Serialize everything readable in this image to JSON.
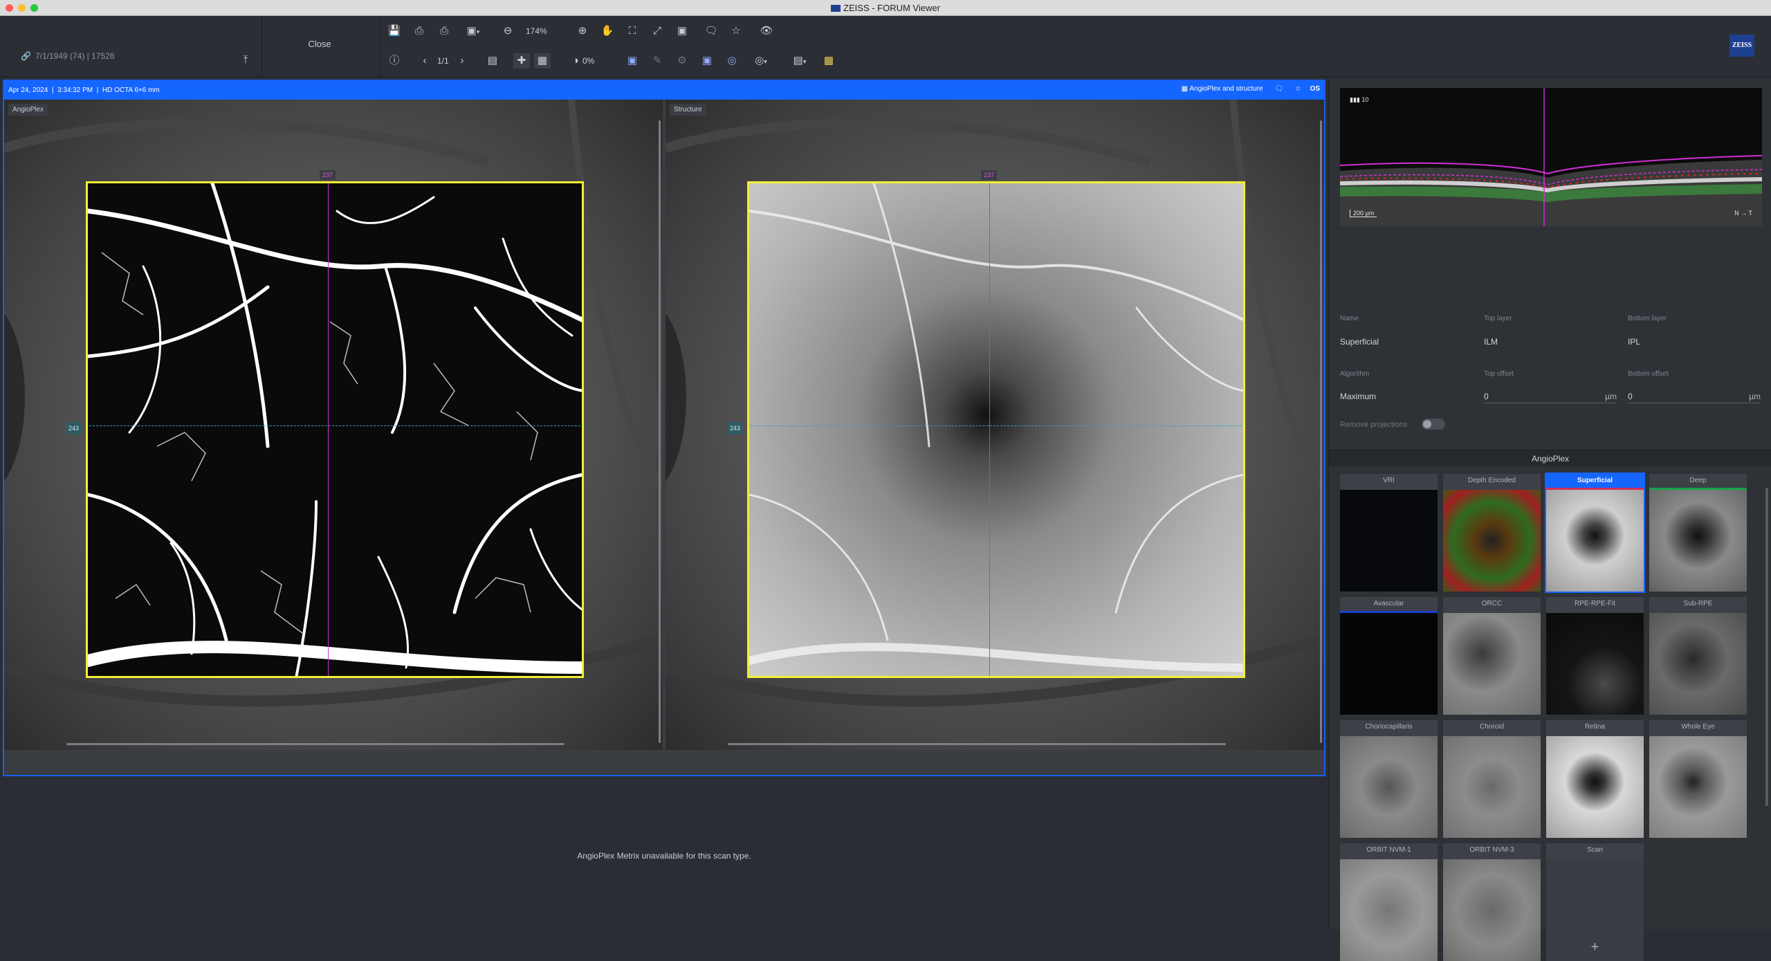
{
  "window": {
    "title": "ZEISS - FORUM Viewer"
  },
  "patient": {
    "info": "7/1/1949 (74)  |  17528"
  },
  "toolbar": {
    "close_label": "Close",
    "zoom_label": "174%",
    "page_label": "1/1",
    "opacity_label": "0%"
  },
  "brand": {
    "logo_text": "ZEISS"
  },
  "viewer": {
    "date": "Apr 24, 2024",
    "time": "3:34:32 PM",
    "scan_type": "HD OCTA 6×6 mm",
    "layout_label": "AngioPlex and structure",
    "eye": "OS",
    "left_pane_label": "AngioPlex",
    "right_pane_label": "Structure",
    "marker_vertical": "237",
    "marker_horizontal": "243"
  },
  "metrix": {
    "message": "AngioPlex Metrix unavailable for this scan type."
  },
  "bscan": {
    "frame_label": "10",
    "scale_label": "200 µm",
    "orientation_left": "N",
    "orientation_right": "T"
  },
  "layer": {
    "name_label": "Name",
    "name_value": "Superficial",
    "top_layer_label": "Top layer",
    "top_layer_value": "ILM",
    "bottom_layer_label": "Bottom layer",
    "bottom_layer_value": "IPL",
    "algorithm_label": "Algorithm",
    "algorithm_value": "Maximum",
    "top_offset_label": "Top offset",
    "top_offset_value": "0",
    "bottom_offset_label": "Bottom offset",
    "bottom_offset_value": "0",
    "unit": "µm",
    "remove_projections_label": "Remove projections"
  },
  "angioplex": {
    "header": "AngioPlex",
    "thumbnails": [
      {
        "label": "VRI"
      },
      {
        "label": "Depth Encoded"
      },
      {
        "label": "Superficial",
        "selected": true
      },
      {
        "label": "Deep"
      },
      {
        "label": "Avascular"
      },
      {
        "label": "ORCC"
      },
      {
        "label": "RPE-RPE-Fit"
      },
      {
        "label": "Sub-RPE"
      },
      {
        "label": "Choriocapillaris"
      },
      {
        "label": "Choroid"
      },
      {
        "label": "Retina"
      },
      {
        "label": "Whole Eye"
      },
      {
        "label": "ORBIT NVM-1"
      },
      {
        "label": "ORBIT NVM-3"
      },
      {
        "label": "Scan"
      }
    ],
    "add_symbol": "+"
  },
  "colors": {
    "accent": "#1565ff",
    "scan_box": "#f1ef34",
    "marker_vertical": "#d02fd6",
    "marker_horizontal": "#33a6b4"
  }
}
